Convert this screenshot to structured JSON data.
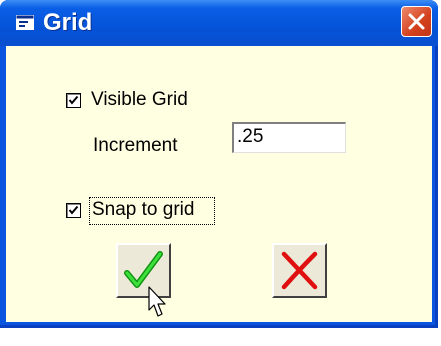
{
  "window": {
    "title": "Grid",
    "title_icon": "form-icon",
    "close_icon": "close-icon"
  },
  "form": {
    "visible_grid": {
      "label": "Visible Grid",
      "checked": true
    },
    "increment": {
      "label": "Increment",
      "value": ".25"
    },
    "snap_to_grid": {
      "label": "Snap to grid",
      "checked": true,
      "focused": true
    }
  },
  "buttons": {
    "ok": {
      "icon": "green-checkmark-icon"
    },
    "cancel": {
      "icon": "red-x-icon"
    }
  },
  "colors": {
    "titlebar": "#0553d8",
    "client_background": "#ffffe1",
    "close_button": "#d3401c",
    "ok_icon": "#22c022",
    "cancel_icon": "#e01010"
  }
}
